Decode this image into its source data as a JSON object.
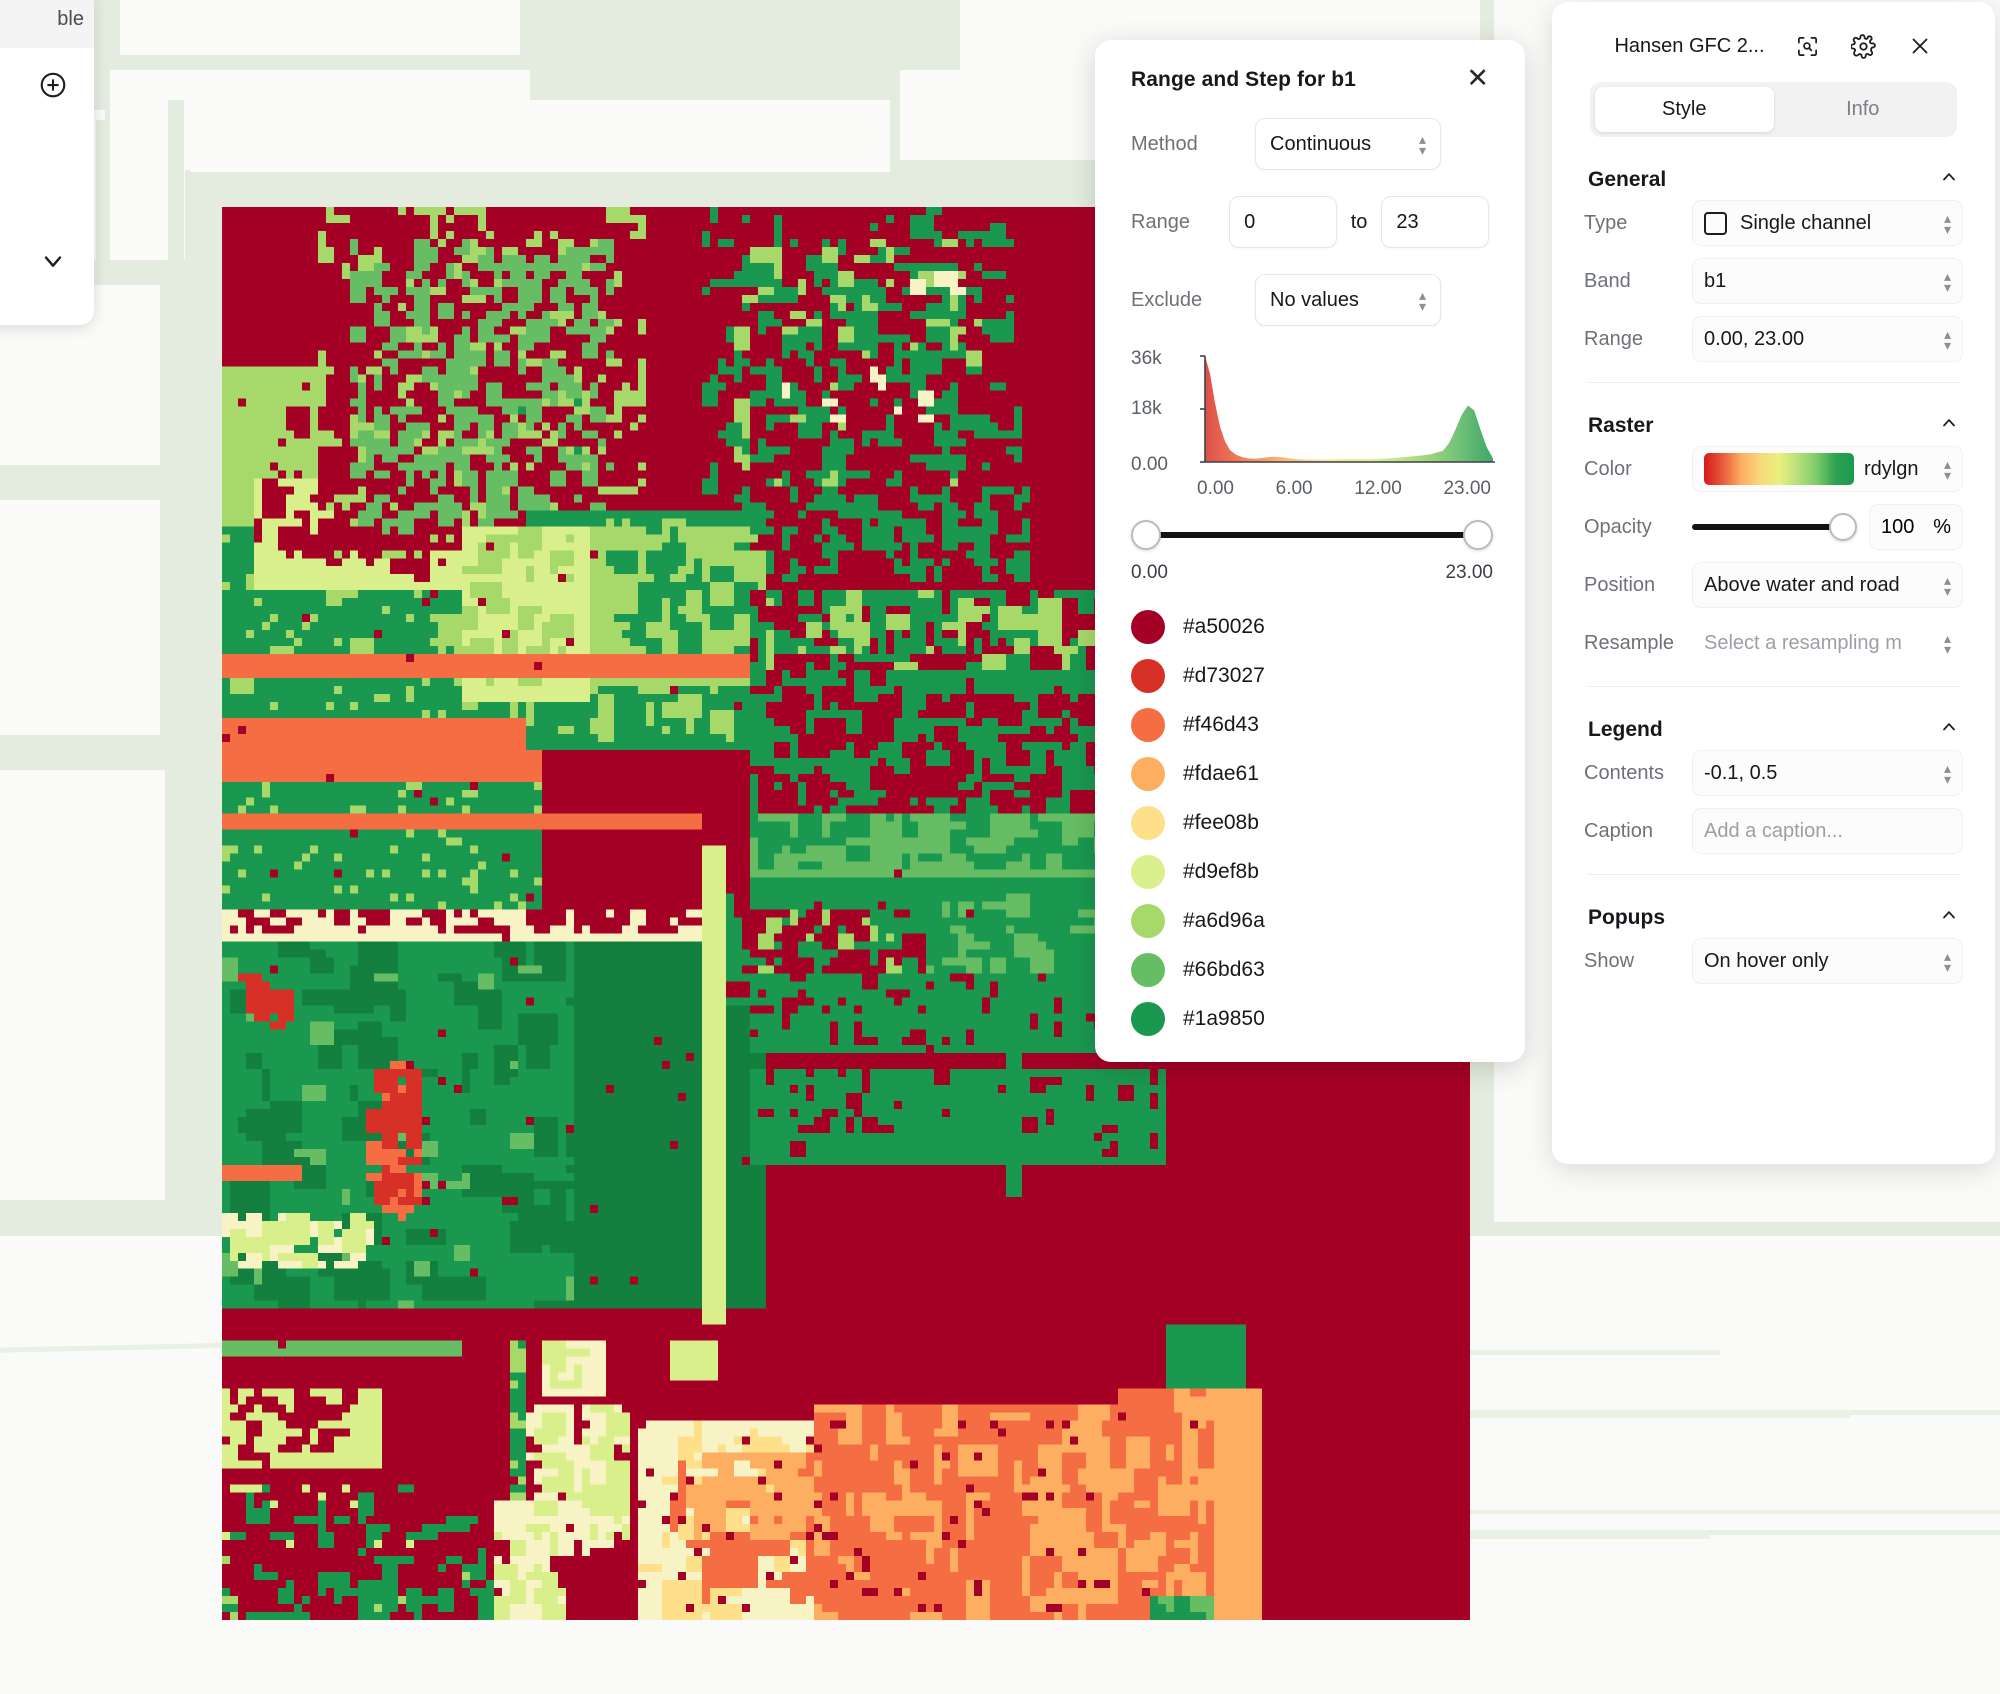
{
  "map": {
    "basemap_color": "#e4ecdf",
    "parcel_color": "#fafaf8",
    "raster_alt": "Hansen Global Forest Change raster tile"
  },
  "left_panel": {
    "clipped_title": "ble",
    "add_icon": "plus-circle-icon",
    "visibility_icon": "eye-icon",
    "expand_icon": "chevron-down-icon"
  },
  "dialog": {
    "title": "Range and Step for b1",
    "close_icon": "close-icon",
    "method_label": "Method",
    "method_value": "Continuous",
    "range_label": "Range",
    "range_min": "0",
    "range_max": "23",
    "to_word": "to",
    "exclude_label": "Exclude",
    "exclude_value": "No values",
    "slider_min_label": "0.00",
    "slider_max_label": "23.00",
    "swatches": [
      {
        "hex": "#a50026",
        "label": "#a50026"
      },
      {
        "hex": "#d73027",
        "label": "#d73027"
      },
      {
        "hex": "#f46d43",
        "label": "#f46d43"
      },
      {
        "hex": "#fdae61",
        "label": "#fdae61"
      },
      {
        "hex": "#fee08b",
        "label": "#fee08b"
      },
      {
        "hex": "#d9ef8b",
        "label": "#d9ef8b"
      },
      {
        "hex": "#a6d96a",
        "label": "#a6d96a"
      },
      {
        "hex": "#66bd63",
        "label": "#66bd63"
      },
      {
        "hex": "#1a9850",
        "label": "#1a9850"
      }
    ]
  },
  "chart_data": {
    "type": "area",
    "title": "",
    "xlabel": "",
    "ylabel": "",
    "x_ticks": [
      "0.00",
      "6.00",
      "12.00",
      "23.00"
    ],
    "y_ticks": [
      "36k",
      "18k",
      "0.00"
    ],
    "ylim": [
      0,
      36000
    ],
    "xlim": [
      0,
      23
    ],
    "grid": false,
    "legend": "none",
    "x": [
      0.0,
      0.4,
      0.8,
      1.2,
      1.6,
      2.0,
      2.5,
      3.0,
      3.5,
      4.0,
      4.5,
      5.0,
      5.5,
      6.0,
      6.5,
      7.0,
      7.5,
      8.0,
      9.0,
      10.0,
      11.0,
      12.0,
      13.0,
      14.0,
      15.0,
      16.0,
      17.0,
      18.0,
      19.0,
      19.5,
      20.0,
      20.5,
      21.0,
      21.5,
      22.0,
      22.5,
      23.0
    ],
    "values": [
      36500,
      30000,
      20000,
      12000,
      7000,
      4000,
      2400,
      1600,
      1200,
      1100,
      1300,
      1600,
      1800,
      1700,
      1400,
      1100,
      900,
      800,
      800,
      900,
      1000,
      1000,
      1000,
      1100,
      1300,
      1700,
      2100,
      2600,
      3800,
      6500,
      11000,
      16000,
      19200,
      17500,
      11000,
      5000,
      1200
    ],
    "fill_gradient": [
      "#d73027",
      "#f46d43",
      "#fdae61",
      "#fee08b",
      "#d9ef8b",
      "#a6d96a",
      "#66bd63",
      "#1a9850"
    ]
  },
  "right_panel": {
    "title": "Hansen GFC 2...",
    "zoom_icon": "zoom-to-layer-icon",
    "settings_icon": "gear-icon",
    "close_icon": "close-icon",
    "tabs": [
      {
        "label": "Style",
        "active": true
      },
      {
        "label": "Info",
        "active": false
      }
    ],
    "general": {
      "heading": "General",
      "collapse_icon": "chevron-up-icon",
      "rows": [
        {
          "label": "Type",
          "value": "Single channel",
          "has_checkbox": true
        },
        {
          "label": "Band",
          "value": "b1",
          "has_checkbox": false
        },
        {
          "label": "Range",
          "value": "0.00, 23.00",
          "has_checkbox": false
        }
      ]
    },
    "raster": {
      "heading": "Raster",
      "collapse_icon": "chevron-up-icon",
      "color_label": "Color",
      "color_value": "rdylgn",
      "opacity_label": "Opacity",
      "opacity_value": "100",
      "opacity_unit": "%",
      "position_label": "Position",
      "position_value": "Above water and road",
      "resample_label": "Resample",
      "resample_placeholder": "Select a resampling m"
    },
    "legend": {
      "heading": "Legend",
      "collapse_icon": "chevron-up-icon",
      "contents_label": "Contents",
      "contents_value": "-0.1, 0.5",
      "caption_label": "Caption",
      "caption_placeholder": "Add a caption..."
    },
    "popups": {
      "heading": "Popups",
      "collapse_icon": "chevron-up-icon",
      "show_label": "Show",
      "show_value": "On hover only"
    }
  }
}
